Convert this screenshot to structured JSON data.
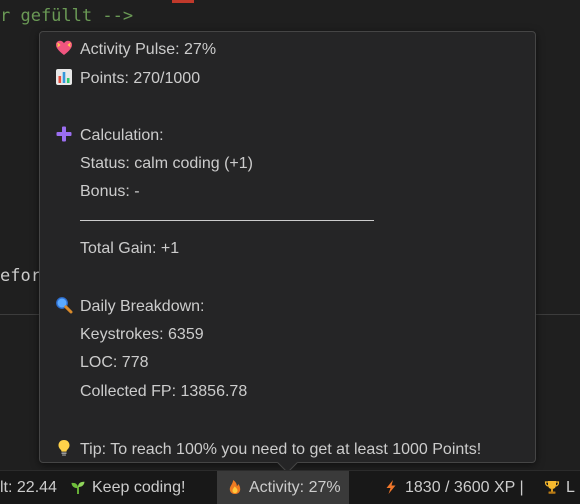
{
  "editor": {
    "comment_line": "r gefüllt -->",
    "code_fragment": "efor"
  },
  "hover": {
    "pulse_label": "Activity Pulse: 27%",
    "points_label": "Points: 270/1000",
    "calculation_heading": "Calculation:",
    "status_line": "Status: calm coding (+1)",
    "bonus_line": "Bonus: -",
    "total_gain_line": "Total Gain: +1",
    "breakdown_heading": "Daily Breakdown:",
    "keystrokes_line": "Keystrokes: 6359",
    "loc_line": "LOC: 778",
    "collected_fp_line": "Collected FP: 13856.78",
    "tip_line": "Tip: To reach 100% you need to get at least 1000 Points!",
    "icons": {
      "pulse": "heart-icon",
      "points": "bar-chart-icon",
      "calculation": "plus-icon",
      "breakdown": "magnifier-icon",
      "tip": "lightbulb-icon"
    }
  },
  "statusbar": {
    "lt_value": "lt: 22.44",
    "keep_coding": "Keep coding!",
    "activity": "Activity: 27%",
    "xp": "1830 / 3600 XP |",
    "level_partial": "L",
    "icons": {
      "keep_coding": "seedling-icon",
      "activity": "flame-icon",
      "xp": "lightning-icon",
      "level": "trophy-icon"
    }
  },
  "colors": {
    "tooltip_bg": "#252526",
    "text": "#cccccc",
    "comment": "#6a9955",
    "active_item_bg": "#3a3a3a"
  }
}
